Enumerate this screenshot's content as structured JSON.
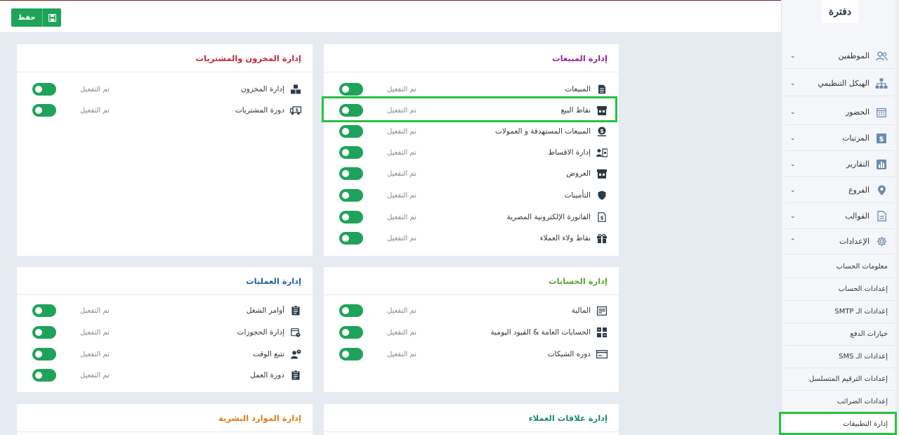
{
  "toolbar": {
    "save_label": "حفظ"
  },
  "logo": {
    "text": "دفترة"
  },
  "sidebar": {
    "items": [
      {
        "label": "الموظفين",
        "icon": "employees-icon",
        "expanded": false
      },
      {
        "label": "الهيكل التنظيمي",
        "icon": "org-chart-icon",
        "expanded": false
      },
      {
        "label": "الحضور",
        "icon": "calendar-icon",
        "expanded": false
      },
      {
        "label": "المرتبات",
        "icon": "salary-icon",
        "expanded": false
      },
      {
        "label": "التقارير",
        "icon": "reports-icon",
        "expanded": false
      },
      {
        "label": "الفروع",
        "icon": "location-pin-icon",
        "expanded": false
      },
      {
        "label": "القوالب",
        "icon": "document-icon",
        "expanded": false
      },
      {
        "label": "الإعدادات",
        "icon": "gear-icon",
        "expanded": true
      }
    ],
    "sub_items": [
      "معلومات الحساب",
      "إعدادات الحساب",
      "إعدادات الـ SMTP",
      "خيارات الدفع",
      "إعدادات الـ SMS",
      "إعدادات الترقيم المتسلسل",
      "إعدادات الضرائب",
      "إدارة التطبيقات"
    ],
    "active_sub": "إدارة التطبيقات"
  },
  "cards": {
    "sales": {
      "title": "إدارة المبيعات",
      "color": "#9c1f9c",
      "rows": [
        {
          "label": "المبيعات",
          "status": "تم التفعيل",
          "icon": "invoice-icon"
        },
        {
          "label": "نقاط البيع",
          "status": "تم التفعيل",
          "icon": "pos-store-icon"
        },
        {
          "label": "المبيعات المستهدفة و العمولات",
          "status": "تم التفعيل",
          "icon": "money-target-icon"
        },
        {
          "label": "إدارة الاقساط",
          "status": "تم التفعيل",
          "icon": "installments-icon"
        },
        {
          "label": "العروض",
          "status": "تم التفعيل",
          "icon": "offers-store-icon"
        },
        {
          "label": "التأمينات",
          "status": "تم التفعيل",
          "icon": "shield-icon"
        },
        {
          "label": "الفاتورة الإلكترونية المصرية",
          "status": "تم التفعيل",
          "icon": "e-invoice-icon"
        },
        {
          "label": "نقاط ولاء العملاء",
          "status": "تم التفعيل",
          "icon": "gift-icon"
        }
      ]
    },
    "inventory": {
      "title": "إدارة المخزون والمشتريات",
      "color": "#c0273a",
      "rows": [
        {
          "label": "إدارة المخزون",
          "status": "تم التفعيل",
          "icon": "boxes-icon"
        },
        {
          "label": "دورة المشتريات",
          "status": "تم التفعيل",
          "icon": "truck-icon"
        }
      ]
    },
    "accounts": {
      "title": "إدارة الحسابات",
      "color": "#5aa532",
      "rows": [
        {
          "label": "المالية",
          "status": "تم التفعيل",
          "icon": "finance-icon"
        },
        {
          "label": "الحسابات العامة & القيود اليومية",
          "status": "تم التفعيل",
          "icon": "ledger-grid-icon"
        },
        {
          "label": "دوره الشيكات",
          "status": "تم التفعيل",
          "icon": "cheque-icon"
        }
      ]
    },
    "operations": {
      "title": "إدارة العمليات",
      "color": "#1f5fa8",
      "rows": [
        {
          "label": "أوامر الشغل",
          "status": "تم التفعيل",
          "icon": "clipboard-icon"
        },
        {
          "label": "إدارة الحجوزات",
          "status": "تم التفعيل",
          "icon": "booking-calendar-icon"
        },
        {
          "label": "تتبع الوقت",
          "status": "تم التفعيل",
          "icon": "time-tracking-icon"
        },
        {
          "label": "دورة العمل",
          "status": "تم التفعيل",
          "icon": "workflow-clipboard-icon"
        }
      ]
    },
    "crm": {
      "title": "إدارة علاقات العملاء",
      "color": "#1a8a6a",
      "rows": []
    },
    "hr": {
      "title": "إدارة الموارد البشرية",
      "color": "#e07a10",
      "rows": []
    }
  },
  "colors": {
    "accent_green": "#1fa35a",
    "highlight": "#28c044",
    "background": "#e6ebf2"
  }
}
